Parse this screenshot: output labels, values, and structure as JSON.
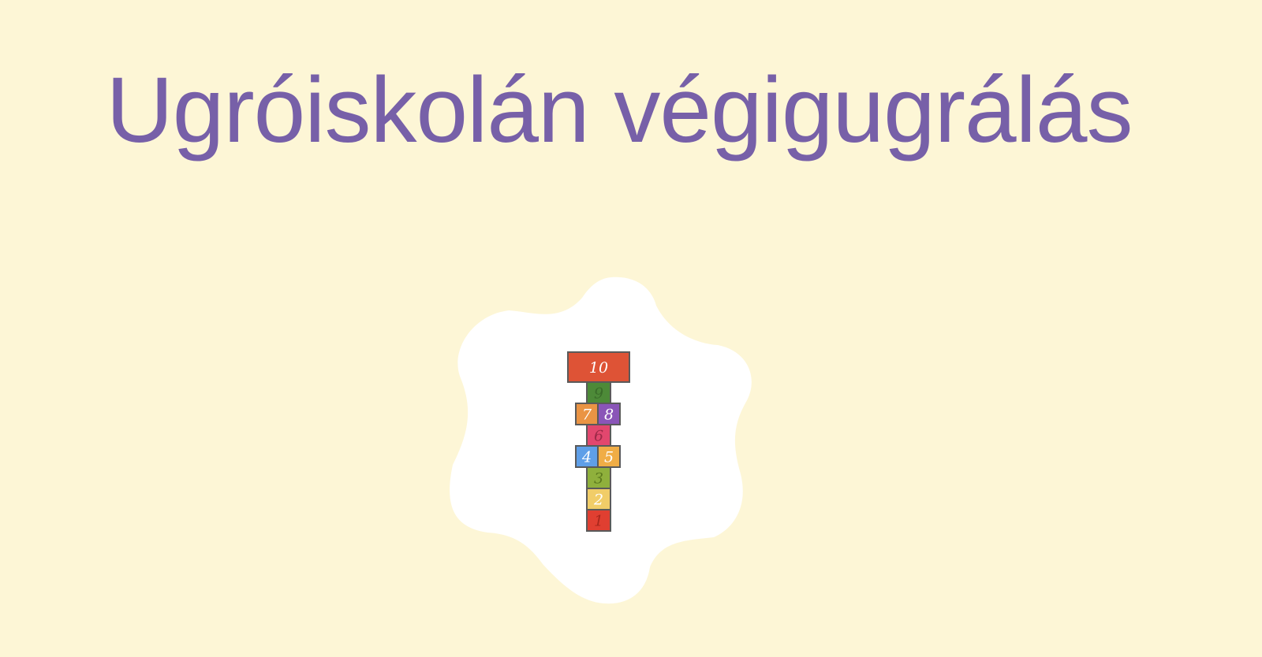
{
  "page": {
    "title": "Ugróiskolán végigugrálás"
  },
  "hopscotch": {
    "tiles": [
      {
        "label": "10",
        "color": "#de5336",
        "text_color": "#ffffff"
      },
      {
        "label": "9",
        "color": "#4d8a38",
        "text_color": "#3a6c2a"
      },
      {
        "label": "7",
        "color": "#ea9444",
        "text_color": "#ffffff"
      },
      {
        "label": "8",
        "color": "#8a55b8",
        "text_color": "#ffffff"
      },
      {
        "label": "6",
        "color": "#e2476e",
        "text_color": "#9c2a48"
      },
      {
        "label": "4",
        "color": "#5f9fe8",
        "text_color": "#ffffff"
      },
      {
        "label": "5",
        "color": "#f0ad46",
        "text_color": "#ffffff"
      },
      {
        "label": "3",
        "color": "#8fb03c",
        "text_color": "#5c7a1e"
      },
      {
        "label": "2",
        "color": "#f1cd68",
        "text_color": "#ffffff"
      },
      {
        "label": "1",
        "color": "#e03f31",
        "text_color": "#a8271c"
      }
    ],
    "blob_color": "#ffffff",
    "outline_color": "#5a5a5a"
  },
  "colors": {
    "background": "#fdf6d6",
    "title": "#7760a8"
  }
}
